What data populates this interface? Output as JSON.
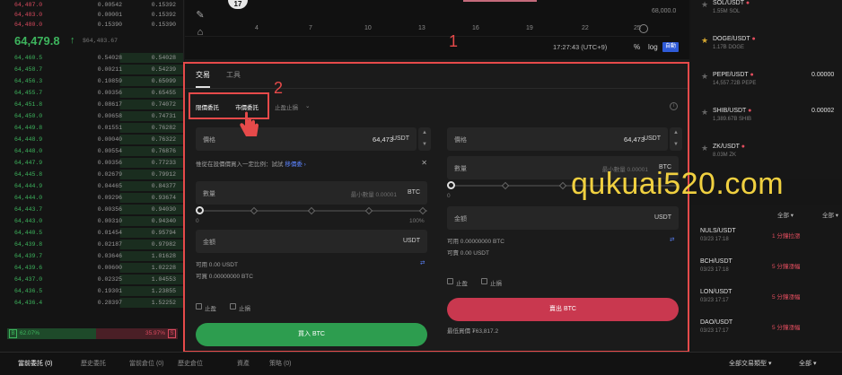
{
  "orderbook": {
    "asks": [
      {
        "price": "64,487.0",
        "amount": "0.00542",
        "total": "0.15392"
      },
      {
        "price": "64,483.0",
        "amount": "0.00001",
        "total": "0.15392"
      },
      {
        "price": "64,480.0",
        "amount": "0.15390",
        "total": "0.15390"
      }
    ],
    "mid_price": "64,479.8",
    "mid_arrow": "↑",
    "mid_sub": "$64,483.67",
    "bids": [
      {
        "price": "64,460.5",
        "amount": "0.54028",
        "total": "0.54028"
      },
      {
        "price": "64,458.7",
        "amount": "0.00211",
        "total": "0.54239"
      },
      {
        "price": "64,456.3",
        "amount": "0.10859",
        "total": "0.65099"
      },
      {
        "price": "64,455.7",
        "amount": "0.00356",
        "total": "0.65455"
      },
      {
        "price": "64,451.8",
        "amount": "0.08617",
        "total": "0.74072"
      },
      {
        "price": "64,450.0",
        "amount": "0.00658",
        "total": "0.74731"
      },
      {
        "price": "64,449.8",
        "amount": "0.01551",
        "total": "0.76282"
      },
      {
        "price": "64,448.9",
        "amount": "0.00040",
        "total": "0.76322"
      },
      {
        "price": "64,448.0",
        "amount": "0.00554",
        "total": "0.76876"
      },
      {
        "price": "64,447.9",
        "amount": "0.00356",
        "total": "0.77233"
      },
      {
        "price": "64,445.8",
        "amount": "0.02679",
        "total": "0.79912"
      },
      {
        "price": "64,444.9",
        "amount": "0.04465",
        "total": "0.84377"
      },
      {
        "price": "64,444.0",
        "amount": "0.09296",
        "total": "0.93674"
      },
      {
        "price": "64,443.7",
        "amount": "0.00356",
        "total": "0.94030"
      },
      {
        "price": "64,443.0",
        "amount": "0.00310",
        "total": "0.94340"
      },
      {
        "price": "64,440.5",
        "amount": "0.01454",
        "total": "0.95794"
      },
      {
        "price": "64,439.8",
        "amount": "0.02187",
        "total": "0.97982"
      },
      {
        "price": "64,439.7",
        "amount": "0.03646",
        "total": "1.01628"
      },
      {
        "price": "64,439.6",
        "amount": "0.00600",
        "total": "1.02228"
      },
      {
        "price": "64,437.0",
        "amount": "0.02325",
        "total": "1.04553"
      },
      {
        "price": "64,436.5",
        "amount": "0.19301",
        "total": "1.23855"
      },
      {
        "price": "64,436.4",
        "amount": "0.28397",
        "total": "1.52252"
      }
    ],
    "buy_ratio": "62.07%",
    "sell_ratio": "35.97%",
    "buy_tag": "B",
    "sell_tag": "S"
  },
  "chart": {
    "logo": "17",
    "x_ticks": [
      "4",
      "7",
      "10",
      "13",
      "16",
      "19",
      "22",
      "25"
    ],
    "price_tick": "68,000.0",
    "time": "17:27:43 (UTC+9)",
    "pct": "%",
    "log": "log",
    "auto": "自動"
  },
  "panel": {
    "tabs": [
      "交易",
      "工具"
    ],
    "subtabs": [
      "限價委託",
      "市價委託",
      "止盈止損"
    ],
    "buy": {
      "price_label": "價格",
      "price_value": "64,473",
      "price_unit": "USDT",
      "hint": "惟從在設價價買入一定比例：試試",
      "hint_link": "移價委",
      "hint_arrow": "›",
      "qty_label": "數量",
      "qty_placeholder": "最小數量 0.00001",
      "qty_unit": "BTC",
      "slider_min": "0",
      "slider_max": "100%",
      "amount_label": "金額",
      "amount_unit": "USDT",
      "avail": "可用 0.00 USDT",
      "can_buy": "可買 0.00000000 BTC",
      "tp": "止盈",
      "sl": "止損",
      "button": "買入 BTC"
    },
    "sell": {
      "price_label": "價格",
      "price_value": "64,473",
      "price_unit": "USDT",
      "qty_label": "數量",
      "qty_placeholder": "最小數量 0.00001",
      "qty_unit": "BTC",
      "slider_min": "0",
      "amount_label": "金額",
      "amount_unit": "USDT",
      "avail": "可用 0.00000000 BTC",
      "can_sell": "可賣 0.00 USDT",
      "tp": "止盈",
      "sl": "止損",
      "button": "賣出 BTC",
      "max_buy": "最低買價 ₮63,817.2"
    },
    "annotation_1": "1",
    "annotation_2": "2"
  },
  "market": [
    {
      "sym": "SOL/USDT",
      "vol": "1.55M SOL",
      "px": "",
      "fav": false
    },
    {
      "sym": "DOGE/USDT",
      "vol": "1.17B DOGE",
      "px": "",
      "fav": true
    },
    {
      "sym": "PEPE/USDT",
      "vol": "14,557.72B PEPE",
      "px": "0.00000",
      "fav": false
    },
    {
      "sym": "SHIB/USDT",
      "vol": "1,389.67B SHIB",
      "px": "0.00002",
      "fav": false
    },
    {
      "sym": "ZK/USDT",
      "vol": "8.03M ZK",
      "px": "",
      "fav": false
    }
  ],
  "watermark": "qukuai520.com",
  "alerts": {
    "head_all": "全部 ▾",
    "head_sel": "全部 ▾",
    "rows": [
      {
        "sym": "NULS/USDT",
        "dt": "03/23 17:18",
        "chg": "1 分鐘拉漲",
        "green": false
      },
      {
        "sym": "BCH/USDT",
        "dt": "03/23 17:18",
        "chg": "5 分鐘漲幅",
        "green": false
      },
      {
        "sym": "LON/USDT",
        "dt": "03/23 17:17",
        "chg": "5 分鐘漲幅",
        "green": false
      },
      {
        "sym": "DAO/USDT",
        "dt": "03/23 17:17",
        "chg": "5 分鐘漲幅",
        "green": false
      }
    ]
  },
  "bottom": {
    "tabs": [
      "當前委託 (0)",
      "歷史委託",
      "當前倉位 (0)",
      "歷史倉位",
      "資產",
      "策略 (0)"
    ],
    "select": "全部交易類型 ▾",
    "select2": "全部 ▾"
  },
  "colors": {
    "accent_green": "#2d9d4f",
    "accent_red": "#c9384f",
    "link_blue": "#5c84ff",
    "annotation": "#e64a4a"
  }
}
